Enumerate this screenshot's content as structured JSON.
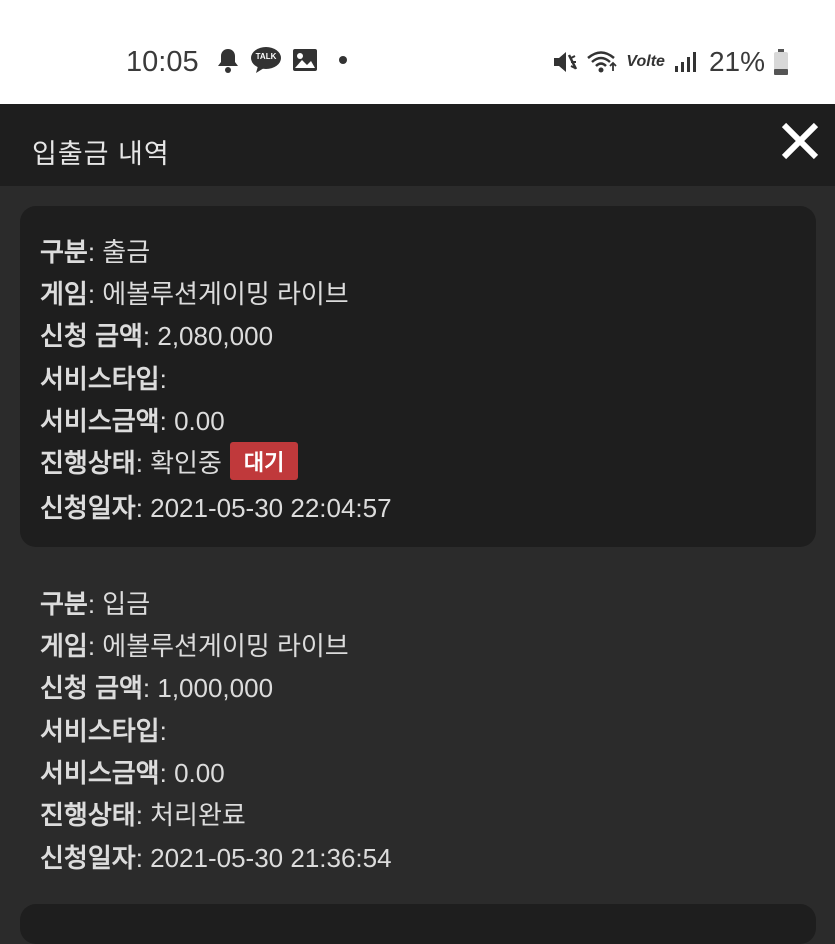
{
  "status_bar": {
    "time": "10:05",
    "left_icons": [
      "bell-icon",
      "kakaotalk-icon",
      "image-icon",
      "dot-icon"
    ],
    "kakaotalk_text": "TALK",
    "volte_text": "Volte",
    "battery_percent": "21%"
  },
  "header": {
    "title": "입출금 내역"
  },
  "records": [
    {
      "type_label": "구분",
      "type_value": "출금",
      "game_label": "게임",
      "game_value": "에볼루션게이밍 라이브",
      "amount_label": "신청 금액",
      "amount_value": "2,080,000",
      "service_type_label": "서비스타입",
      "service_type_value": "",
      "service_amount_label": "서비스금액",
      "service_amount_value": "0.00",
      "status_label": "진행상태",
      "status_value": "확인중",
      "status_badge": "대기",
      "date_label": "신청일자",
      "date_value": "2021-05-30 22:04:57"
    },
    {
      "type_label": "구분",
      "type_value": "입금",
      "game_label": "게임",
      "game_value": "에볼루션게이밍 라이브",
      "amount_label": "신청 금액",
      "amount_value": "1,000,000",
      "service_type_label": "서비스타입",
      "service_type_value": "",
      "service_amount_label": "서비스금액",
      "service_amount_value": "0.00",
      "status_label": "진행상태",
      "status_value": "처리완료",
      "date_label": "신청일자",
      "date_value": "2021-05-30 21:36:54"
    }
  ],
  "colors": {
    "background": "#2b2b2b",
    "card": "#1e1e1e",
    "badge": "#c0393b"
  }
}
